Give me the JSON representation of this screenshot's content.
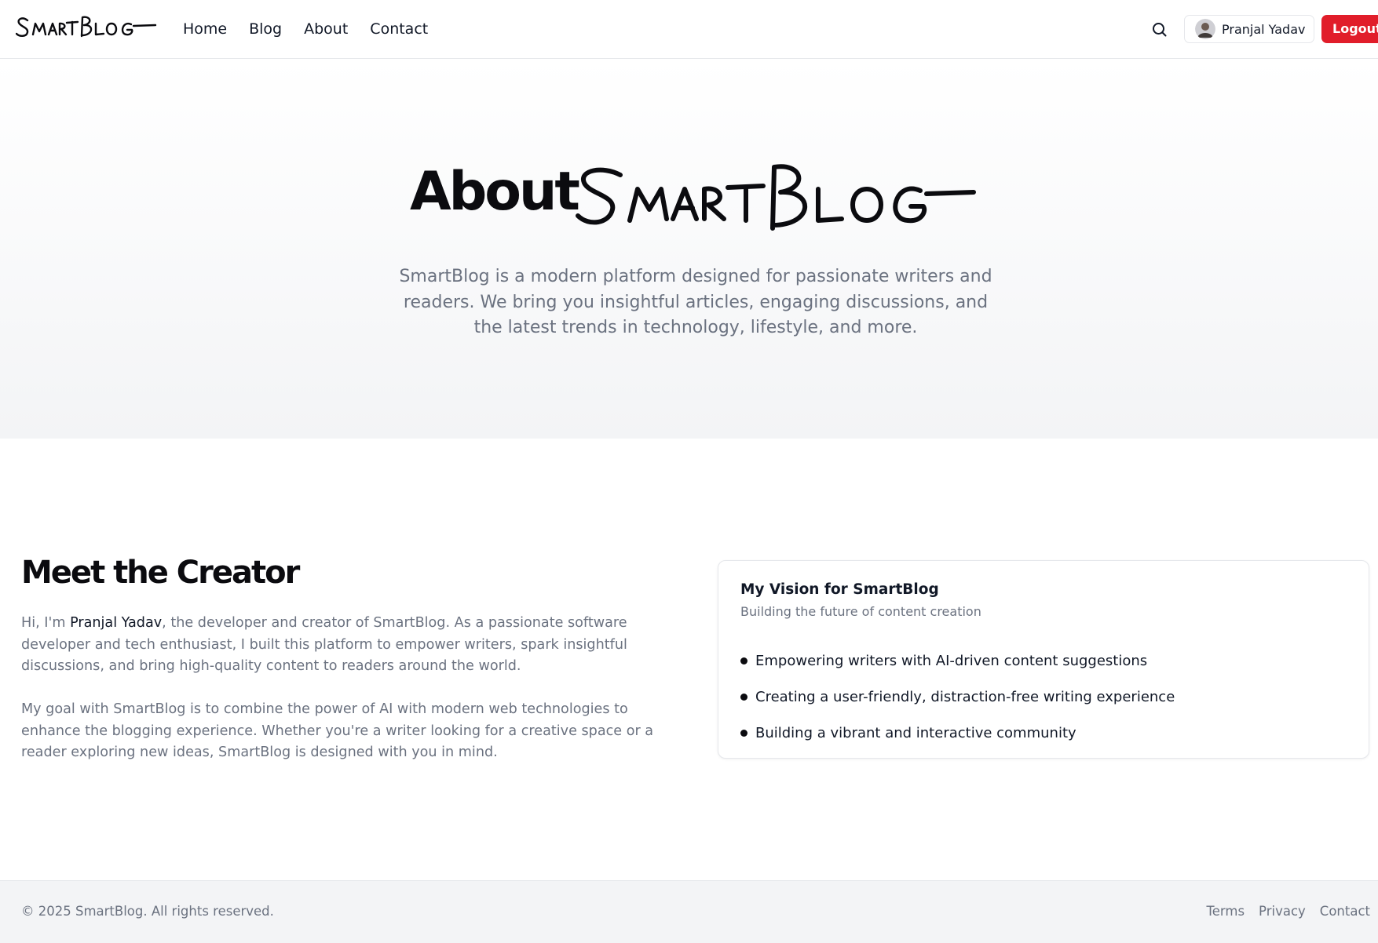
{
  "brand": {
    "logo_text": "SmartBlog"
  },
  "nav": {
    "items": [
      "Home",
      "Blog",
      "About",
      "Contact"
    ]
  },
  "header": {
    "search_icon": "search-icon",
    "user_name": "Pranjal Yadav",
    "logout_label": "Logout",
    "logout_color": "#e11d2a"
  },
  "hero": {
    "title_prefix": "About",
    "title_logo": "SmartBlog",
    "description": "SmartBlog is a modern platform designed for passionate writers and readers. We bring you insightful articles, engaging discussions, and the latest trends in technology, lifestyle, and more."
  },
  "creator": {
    "title": "Meet the Creator",
    "p1_before": "Hi, I'm ",
    "p1_name": "Pranjal Yadav",
    "p1_after": ", the developer and creator of SmartBlog. As a passionate software developer and tech enthusiast, I built this platform to empower writers, spark insightful discussions, and bring high-quality content to readers around the world.",
    "p2": "My goal with SmartBlog is to combine the power of AI with modern web technologies to enhance the blogging experience. Whether you're a writer looking for a creative space or a reader exploring new ideas, SmartBlog is designed with you in mind."
  },
  "vision": {
    "title": "My Vision for SmartBlog",
    "subtitle": "Building the future of content creation",
    "items": [
      "Empowering writers with AI-driven content suggestions",
      "Creating a user-friendly, distraction-free writing experience",
      "Building a vibrant and interactive community"
    ]
  },
  "footer": {
    "copyright": "© 2025 SmartBlog. All rights reserved.",
    "links": [
      "Terms",
      "Privacy",
      "Contact"
    ]
  }
}
